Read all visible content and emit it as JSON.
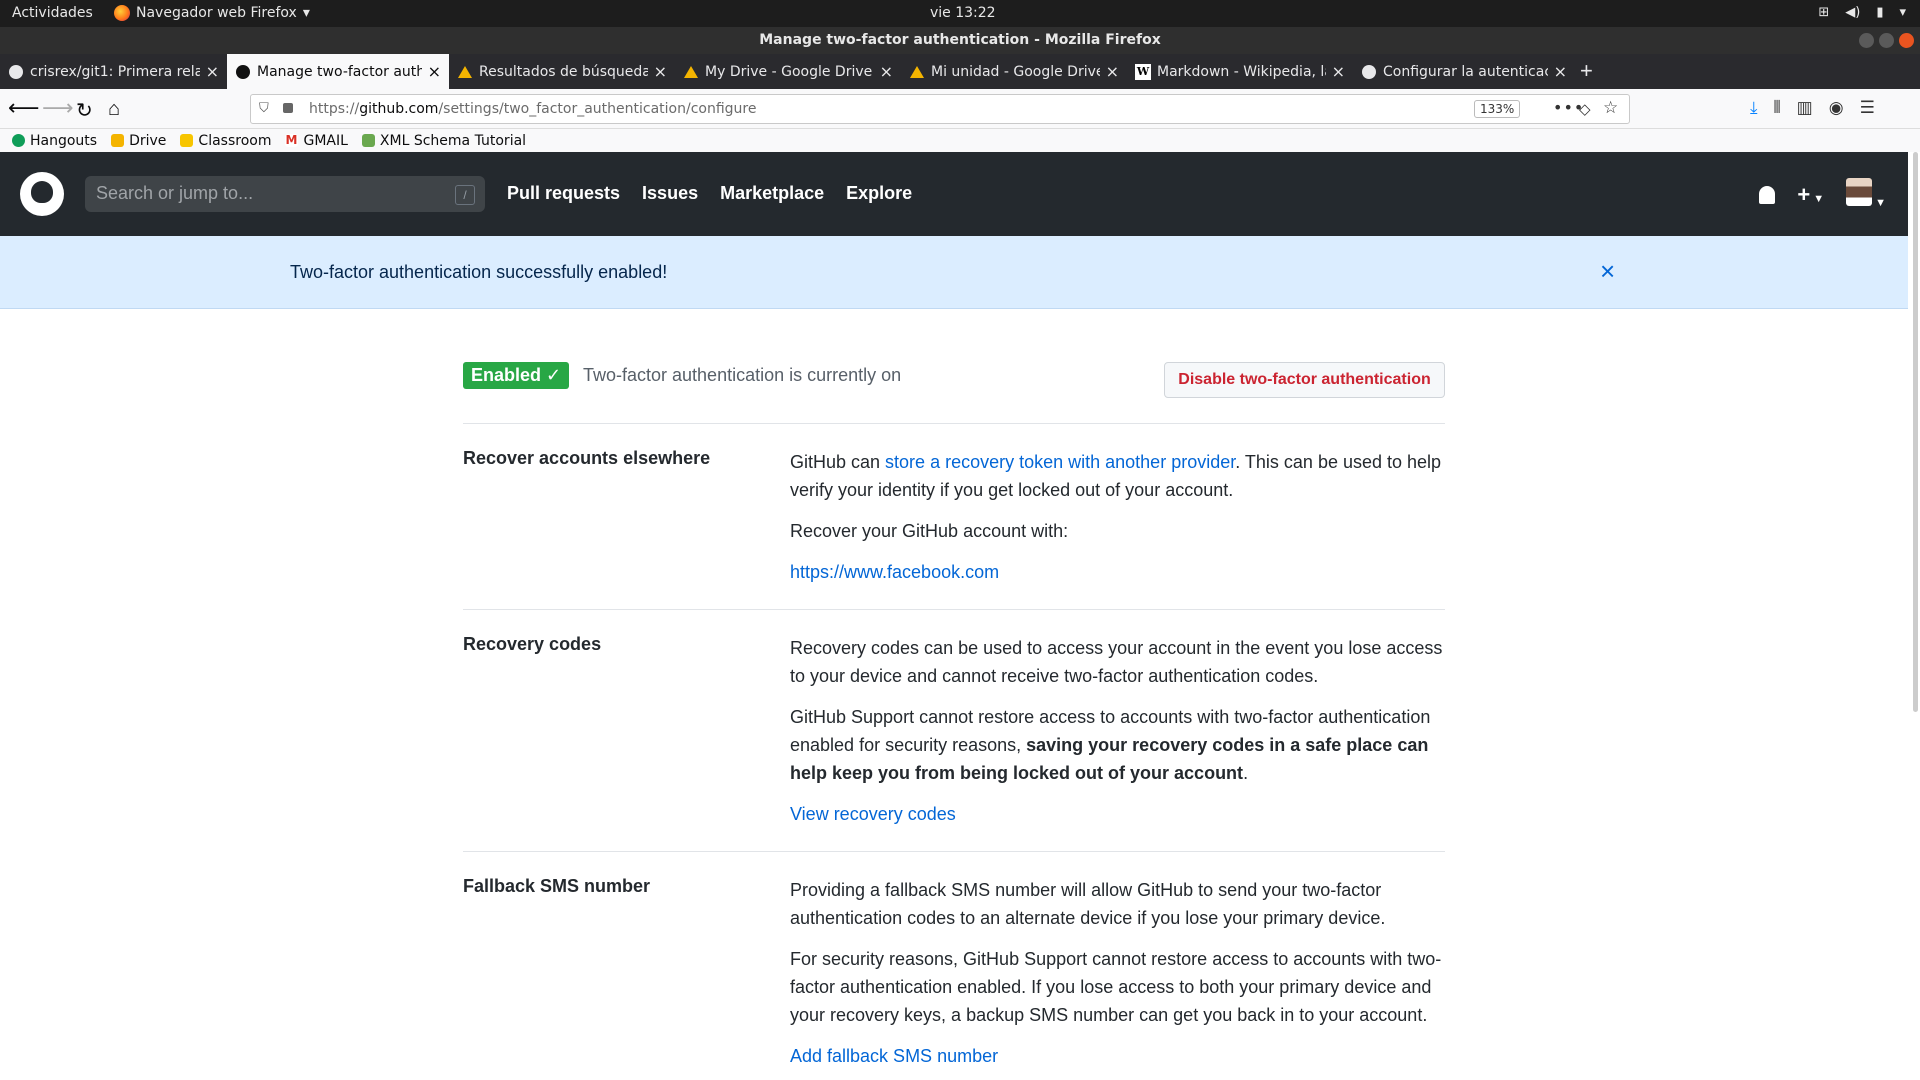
{
  "os": {
    "activities": "Actividades",
    "app_name": "Navegador web Firefox",
    "clock": "vie 13:22"
  },
  "window": {
    "title": "Manage two-factor authentication - Mozilla Firefox"
  },
  "tabs": [
    {
      "label": "crisrex/git1: Primera rela",
      "icon": "github-icon"
    },
    {
      "label": "Manage two-factor authe",
      "icon": "github-icon",
      "active": true
    },
    {
      "label": "Resultados de búsqueda",
      "icon": "google-drive-icon"
    },
    {
      "label": "My Drive - Google Drive",
      "icon": "google-drive-icon"
    },
    {
      "label": "Mi unidad - Google Drive",
      "icon": "google-drive-icon"
    },
    {
      "label": "Markdown - Wikipedia, la",
      "icon": "wikipedia-icon"
    },
    {
      "label": "Configurar la autenticac",
      "icon": "github-icon"
    }
  ],
  "navbar": {
    "url_prefix": "https://",
    "url_domain": "github.com",
    "url_path": "/settings/two_factor_authentication/configure",
    "zoom": "133%"
  },
  "bookmarks": [
    {
      "label": "Hangouts",
      "color": "#0f9d58"
    },
    {
      "label": "Drive",
      "color": "#f4b400"
    },
    {
      "label": "Classroom",
      "color": "#f7c500"
    },
    {
      "label": "GMAIL",
      "color": "#d93025"
    },
    {
      "label": "XML Schema Tutorial",
      "color": "#6aa84f"
    }
  ],
  "github": {
    "search_placeholder": "Search or jump to...",
    "search_hotkey": "/",
    "nav": [
      "Pull requests",
      "Issues",
      "Marketplace",
      "Explore"
    ],
    "plus": "+"
  },
  "flash": {
    "message": "Two-factor authentication successfully enabled!",
    "close": "×"
  },
  "status": {
    "badge": "Enabled ✓",
    "text": "Two-factor authentication is currently on",
    "disable_button": "Disable two-factor authentication"
  },
  "recover": {
    "title": "Recover accounts elsewhere",
    "p1_before": "GitHub can ",
    "p1_link": "store a recovery token with another provider",
    "p1_after": ". This can be used to help verify your identity if you get locked out of your account.",
    "p2": "Recover your GitHub account with:",
    "provider_link": "https://www.facebook.com"
  },
  "recovery_codes": {
    "title": "Recovery codes",
    "p1": "Recovery codes can be used to access your account in the event you lose access to your device and cannot receive two-factor authentication codes.",
    "p2_before": "GitHub Support cannot restore access to accounts with two-factor authentication enabled for security reasons, ",
    "p2_bold": "saving your recovery codes in a safe place can help keep you from being locked out of your account",
    "p2_after": ".",
    "link": "View recovery codes"
  },
  "sms": {
    "title": "Fallback SMS number",
    "p1": "Providing a fallback SMS number will allow GitHub to send your two-factor authentication codes to an alternate device if you lose your primary device.",
    "p2": "For security reasons, GitHub Support cannot restore access to accounts with two-factor authentication enabled. If you lose access to both your primary device and your recovery keys, a backup SMS number can get you back in to your account.",
    "link": "Add fallback SMS number"
  }
}
